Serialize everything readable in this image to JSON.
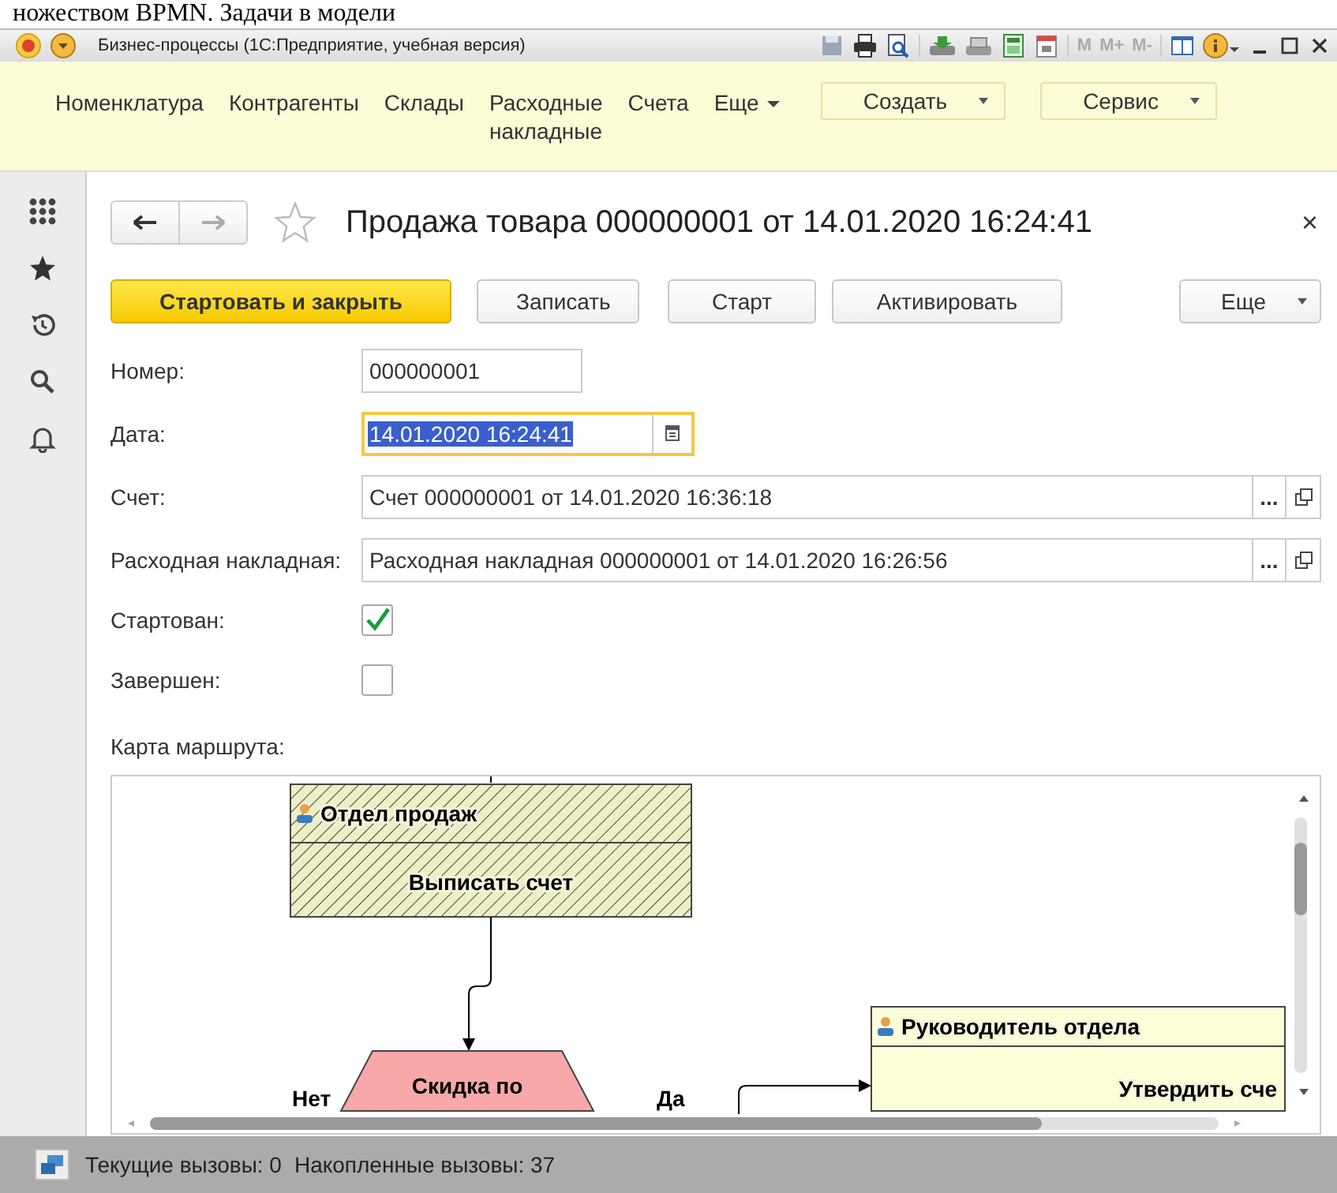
{
  "doc_text": "ножеством BPMN. Задачи в модели",
  "window": {
    "title": "Бизнес-процессы  (1С:Предприятие, учебная версия)",
    "memory_buttons": [
      "M",
      "M+",
      "M-"
    ]
  },
  "nav": [
    {
      "label": "Номенклатура",
      "kind": "link"
    },
    {
      "label": "Контрагенты",
      "kind": "link"
    },
    {
      "label": "Склады",
      "kind": "link"
    },
    {
      "label": "Расходные накладные",
      "kind": "link"
    },
    {
      "label": "Счета",
      "kind": "link"
    },
    {
      "label": "Еще",
      "kind": "menu"
    },
    {
      "label": "Создать",
      "kind": "dropdown"
    },
    {
      "label": "Сервис",
      "kind": "dropdown"
    }
  ],
  "form": {
    "title": "Продажа товара 000000001 от 14.01.2020 16:24:41",
    "close": "×",
    "buttons": [
      {
        "label": "Стартовать и закрыть",
        "kind": "primary"
      },
      {
        "label": "Записать",
        "kind": "normal"
      },
      {
        "label": "Старт",
        "kind": "normal"
      },
      {
        "label": "Активировать",
        "kind": "normal"
      },
      {
        "label": "Еще",
        "kind": "more"
      }
    ],
    "fields": [
      {
        "label": "Номер:",
        "kind": "text",
        "value": "000000001"
      },
      {
        "label": "Дата:",
        "kind": "date",
        "value": "14.01.2020 16:24:41",
        "focused": true
      },
      {
        "label": "Счет:",
        "kind": "ref",
        "value": "Счет 000000001 от 14.01.2020 16:36:18",
        "choice": "..."
      },
      {
        "label": "Расходная накладная:",
        "kind": "ref",
        "value": "Расходная накладная 000000001 от 14.01.2020 16:26:56",
        "choice": "..."
      },
      {
        "label": "Стартован:",
        "kind": "checkbox",
        "checked": true
      },
      {
        "label": "Завершен:",
        "kind": "checkbox",
        "checked": false
      }
    ],
    "route_map": {
      "label": "Карта маршрута:",
      "tasks": [
        {
          "group": "Отдел продаж",
          "name": "Выписать счет",
          "hatched": true
        },
        {
          "group": "Руководитель отдела",
          "name": "Утвердить сче",
          "hatched": false
        }
      ],
      "decision": {
        "name": "Скидка по"
      },
      "branches": [
        "Нет",
        "Да"
      ]
    }
  },
  "status_bar": {
    "current": "Текущие вызовы: 0",
    "accumulated": "Накопленные вызовы: 37"
  }
}
